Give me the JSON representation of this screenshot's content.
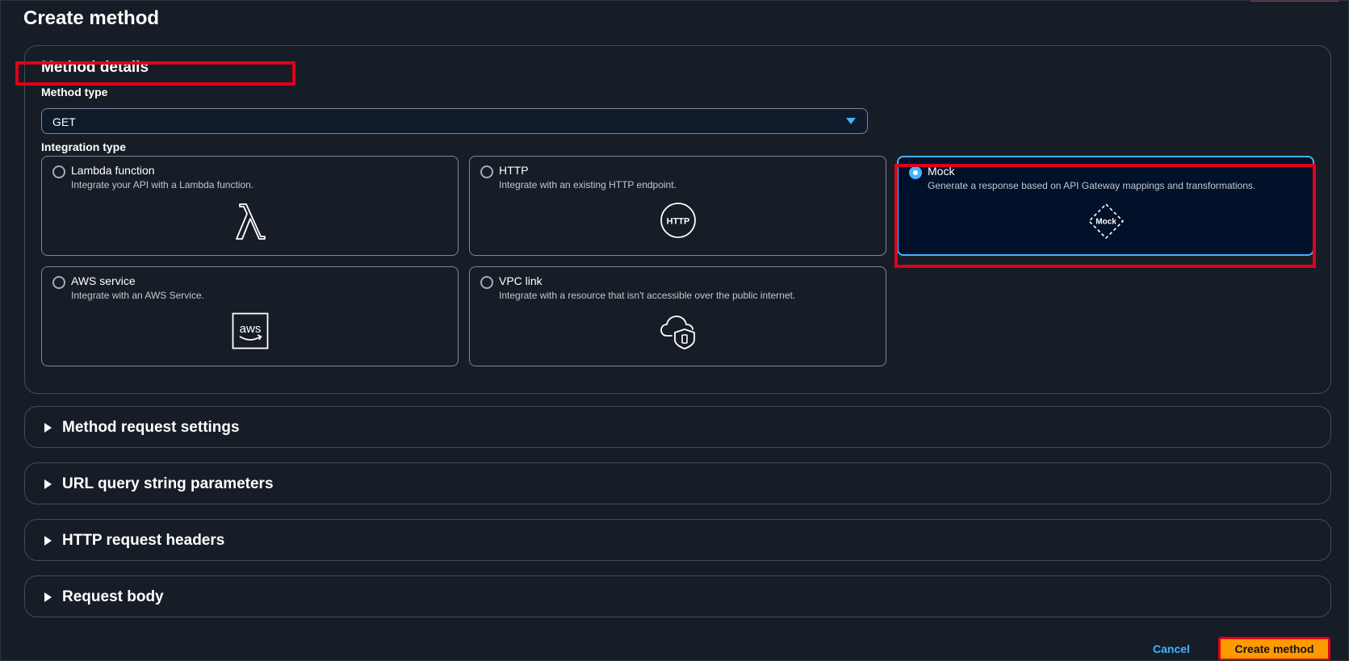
{
  "page": {
    "title": "Create method"
  },
  "method_details": {
    "title": "Method details",
    "method_type_label": "Method type",
    "method_type_value": "GET",
    "integration_type_label": "Integration type",
    "options": [
      {
        "title": "Lambda function",
        "description": "Integrate your API with a Lambda function.",
        "icon": "lambda-icon",
        "selected": false
      },
      {
        "title": "HTTP",
        "description": "Integrate with an existing HTTP endpoint.",
        "icon": "http-icon",
        "icon_text": "HTTP",
        "selected": false
      },
      {
        "title": "Mock",
        "description": "Generate a response based on API Gateway mappings and transformations.",
        "icon": "mock-icon",
        "icon_text": "Mock",
        "selected": true
      },
      {
        "title": "AWS service",
        "description": "Integrate with an AWS Service.",
        "icon": "aws-icon",
        "icon_text": "aws",
        "selected": false
      },
      {
        "title": "VPC link",
        "description": "Integrate with a resource that isn't accessible over the public internet.",
        "icon": "vpc-link-icon",
        "selected": false
      }
    ]
  },
  "sections": [
    {
      "label": "Method request settings"
    },
    {
      "label": "URL query string parameters"
    },
    {
      "label": "HTTP request headers"
    },
    {
      "label": "Request body"
    }
  ],
  "footer": {
    "cancel_label": "Cancel",
    "create_label": "Create method"
  },
  "colors": {
    "background": "#161d26",
    "accent": "#42b4ff",
    "primary_button": "#ff9900",
    "highlight": "#e0001b"
  }
}
